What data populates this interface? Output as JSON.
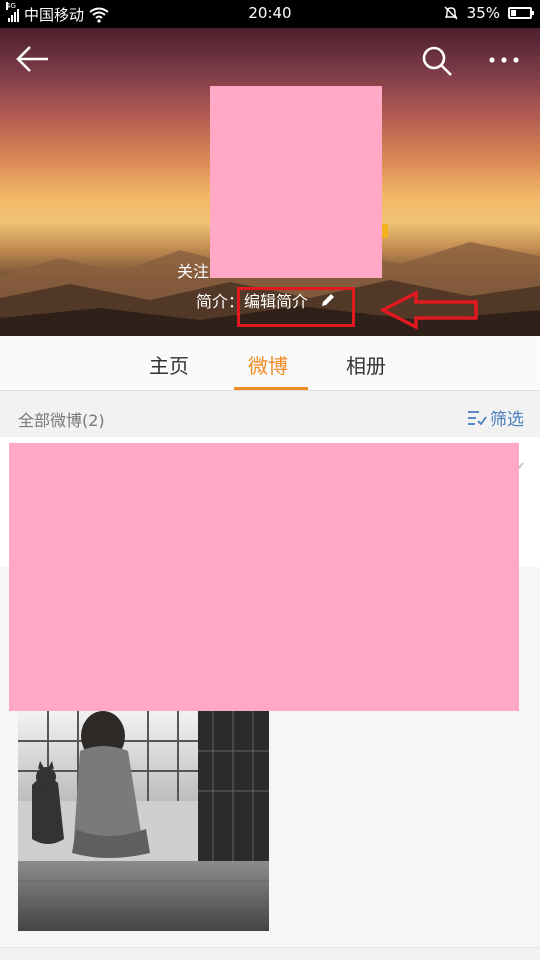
{
  "status_bar": {
    "carrier": "中国移动",
    "network": "4G",
    "time": "20:40",
    "battery_percent": "35%",
    "battery_level": 0.35
  },
  "header": {
    "follow_text": "关注",
    "bio_prefix": "简介：",
    "bio_edit_label": "编辑简介"
  },
  "tabs": [
    {
      "label": "主页"
    },
    {
      "label": "微博",
      "active": true
    },
    {
      "label": "相册"
    }
  ],
  "list": {
    "all_posts_label": "全部微博(2)",
    "filter_label": "筛选"
  },
  "colors": {
    "accent": "#f08a24",
    "link": "#4a7cbf",
    "annotation": "#e0191f",
    "redaction": "#ffa9c6"
  },
  "icons": [
    "back-arrow-icon",
    "search-icon",
    "more-icon",
    "pencil-icon",
    "filter-icon",
    "chevron-down-icon",
    "signal-icon",
    "wifi-icon",
    "bell-off-icon",
    "battery-icon"
  ]
}
